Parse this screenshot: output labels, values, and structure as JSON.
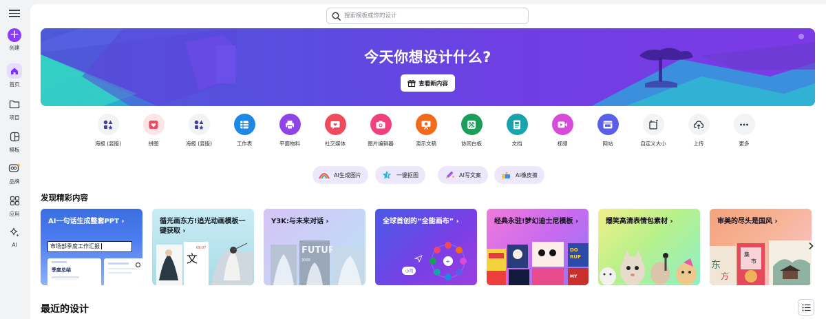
{
  "sidebar": {
    "create": "创建",
    "home": "首页",
    "projects": "项目",
    "templates": "模板",
    "brand": "品牌",
    "apps": "应用",
    "ai": "AI"
  },
  "search": {
    "placeholder": "搜索模板或你的设计"
  },
  "hero": {
    "title": "今天你想设计什么?",
    "button": "查看新内容"
  },
  "design_types": [
    {
      "label": "海报 (竖版)",
      "icon": "shapes-icon",
      "color": "#f2f3f5"
    },
    {
      "label": "拼图",
      "icon": "collage-icon",
      "color": "#fde4e6"
    },
    {
      "label": "海报 (竖版)",
      "icon": "shapes-icon",
      "color": "#f2f3f5"
    },
    {
      "label": "工作表",
      "icon": "sheet-icon",
      "color": "#1e88e5"
    },
    {
      "label": "平面物料",
      "icon": "print-icon",
      "color": "#8e44e6"
    },
    {
      "label": "社交媒体",
      "icon": "heart-icon",
      "color": "#ef4b5c"
    },
    {
      "label": "图片编辑器",
      "icon": "camera-icon",
      "color": "#f0427a"
    },
    {
      "label": "演示文稿",
      "icon": "presentation-icon",
      "color": "#f26a1b"
    },
    {
      "label": "协同白板",
      "icon": "whiteboard-icon",
      "color": "#1a9e5a"
    },
    {
      "label": "文档",
      "icon": "doc-icon",
      "color": "#19a3ad"
    },
    {
      "label": "视频",
      "icon": "video-icon",
      "color": "#d64bd8"
    },
    {
      "label": "网站",
      "icon": "website-icon",
      "color": "#5b5fe8"
    },
    {
      "label": "自定义大小",
      "icon": "custom-size-icon",
      "color": "#f2f3f5"
    },
    {
      "label": "上传",
      "icon": "upload-icon",
      "color": "#f2f3f5"
    },
    {
      "label": "更多",
      "icon": "more-icon",
      "color": "#f2f3f5"
    }
  ],
  "ai_tools": [
    {
      "label": "AI生成图片",
      "icon": "rainbow-icon"
    },
    {
      "label": "一键抠图",
      "icon": "star-icon"
    },
    {
      "label": "AI写文案",
      "icon": "pen-icon"
    },
    {
      "label": "AI橡皮擦",
      "icon": "eraser-icon"
    }
  ],
  "discover": {
    "title": "发现精彩内容",
    "cards": [
      {
        "title": "AI一句话生成整套PPT ›",
        "input": "市场部季度工作汇报",
        "slide_title": "季度总结"
      },
      {
        "title": "循光画东方!追光动画模板一键获取 ›"
      },
      {
        "title": "Y3K:与未来对话 ›",
        "poster_text": "FUTURE"
      },
      {
        "title": "全球首创的“全能画布” ›",
        "chip": "小司"
      },
      {
        "title": "经典永驻!梦幻迪士尼模板 ›"
      },
      {
        "title": "爆笑高清表情包素材 ›"
      },
      {
        "title": "审美的尽头是国风 ›",
        "poster_text": "东方 集市"
      }
    ]
  },
  "recent": {
    "title": "最近的设计"
  }
}
